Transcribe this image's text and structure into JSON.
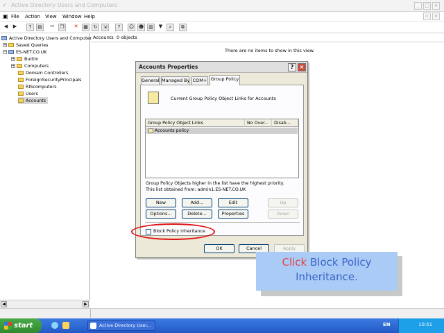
{
  "window": {
    "title": "Active Directory Users and Computers"
  },
  "menu": [
    "File",
    "Action",
    "View",
    "Window",
    "Help"
  ],
  "tree": {
    "root": "Active Directory Users and Computers",
    "items": [
      "Saved Queries",
      "ES-NET.CO.UK",
      "Builtin",
      "Computers",
      "Domain Controllers",
      "ForeignSecurityPrincipals",
      "RIScomputers",
      "Users",
      "Accounts"
    ],
    "selected": "Accounts"
  },
  "right_pane": {
    "header_name": "Accounts",
    "header_count": "0 objects",
    "empty_text": "There are no items to show in this view."
  },
  "dialog": {
    "title": "Accounts Properties",
    "tabs": [
      "General",
      "Managed By",
      "COM+",
      "Group Policy"
    ],
    "active_tab": "Group Policy",
    "current_links_text": "Current Group Policy Object Links for Accounts",
    "columns": [
      "Group Policy Object Links",
      "No Over...",
      "Disab..."
    ],
    "rows": [
      "Accounts policy"
    ],
    "info_line1": "Group Policy Objects higher in the list have the highest priority.",
    "info_line2": "This list obtained from: admin1.ES-NET.CO.UK",
    "buttons": {
      "new": "New",
      "add": "Add...",
      "edit": "Edit",
      "up": "Up",
      "options": "Options...",
      "delete": "Delete...",
      "properties": "Properties",
      "down": "Down"
    },
    "block_inheritance_label": "Block Policy inheritance",
    "block_inheritance_checked": false,
    "ok": "OK",
    "cancel": "Cancel",
    "apply": "Apply"
  },
  "callout": {
    "word1": "Click",
    "word2": "Block Policy",
    "word3": "Inheritance.",
    "color_click": "#e8404a",
    "color_text": "#3a64c8"
  },
  "taskbar": {
    "start": "start",
    "task": "Active Directory User...",
    "lang": "EN",
    "clock": "10:51"
  }
}
